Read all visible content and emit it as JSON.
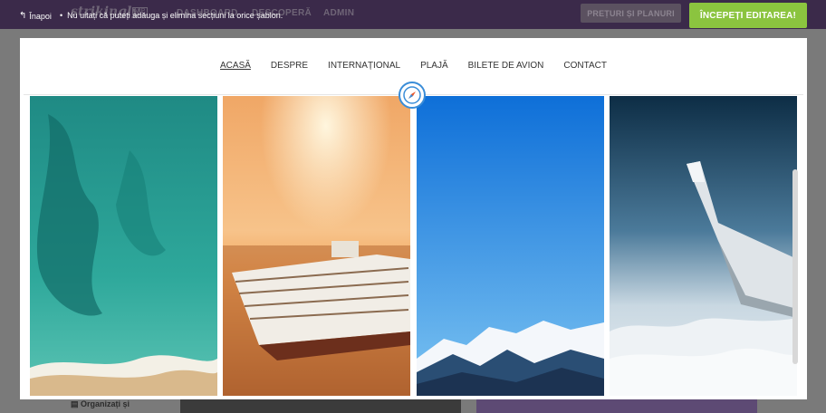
{
  "back": {
    "label": "Înapoi"
  },
  "hint": "Nu uitați că puteți adăuga și elimina secțiuni la orice șablon.",
  "actions": {
    "pricing_label": "PREȚURI ȘI PLANURI",
    "start_label": "ÎNCEPEȚI EDITAREA!"
  },
  "background_app": {
    "logo": "strikingly",
    "vip": "VIP",
    "nav": [
      "DASHBOARD",
      "DESCOPERĂ",
      "ADMIN"
    ],
    "organize_label": "Organizați și"
  },
  "site_nav": [
    "ACASĂ",
    "DESPRE",
    "INTERNAȚIONAL",
    "PLAJĂ",
    "BILETE DE AVION",
    "CONTACT"
  ],
  "colors": {
    "accent_green": "#8bc43f",
    "topbar_purple": "#3b2a4a",
    "compass_blue": "#3a8dd8"
  },
  "icons": {
    "back": "arrow-return-left-icon",
    "compass": "compass-icon"
  }
}
